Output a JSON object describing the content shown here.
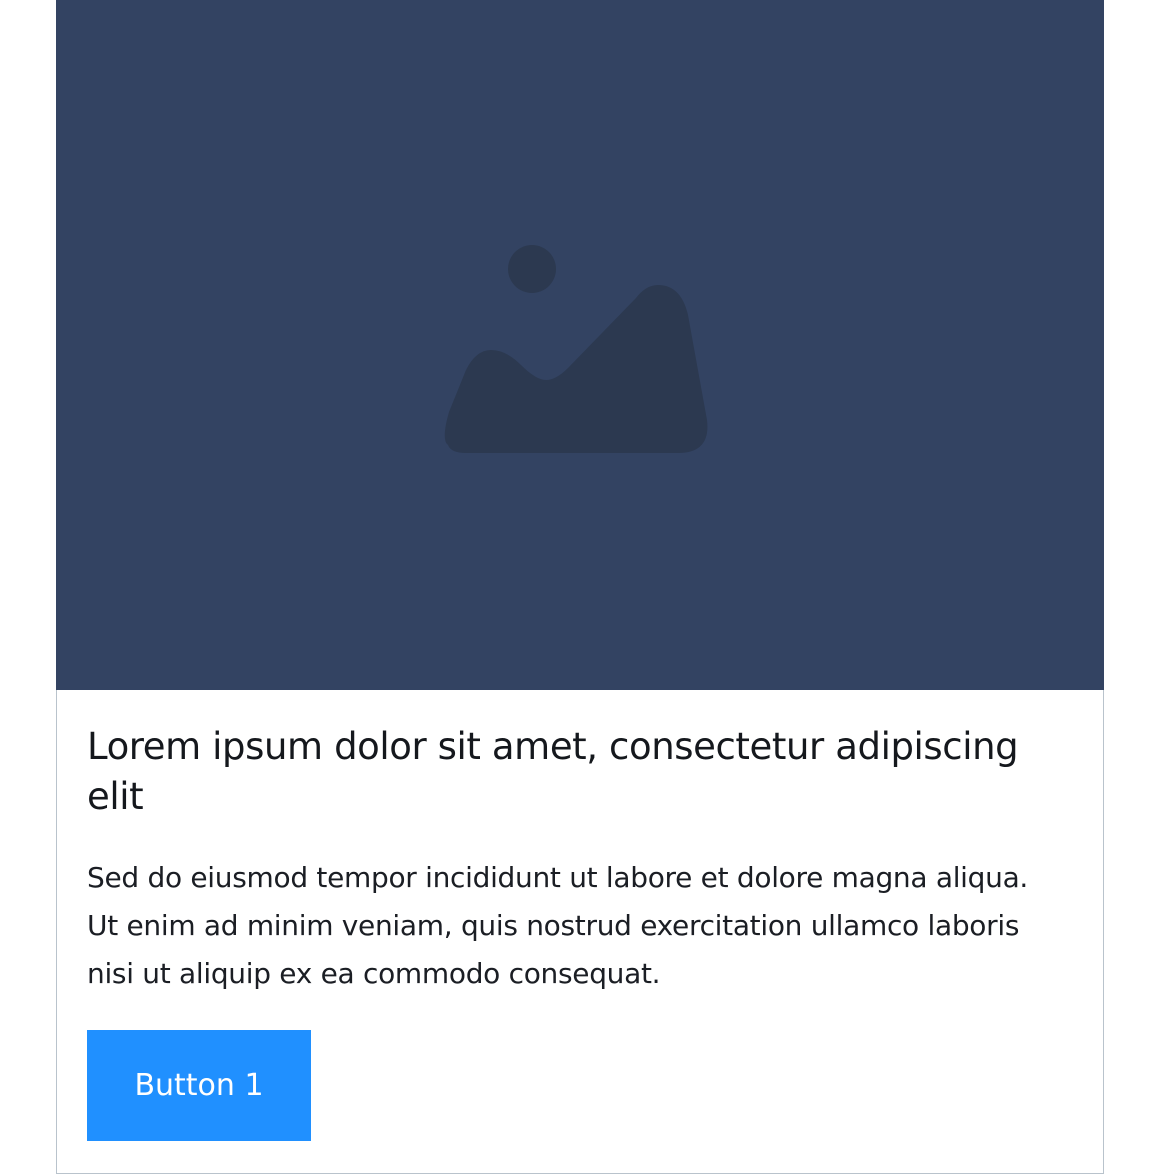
{
  "card": {
    "image": {
      "icon": "image-placeholder-icon",
      "background_color": "#334362",
      "icon_color": "#2c3950"
    },
    "title": "Lorem ipsum dolor sit amet, consectetur adipiscing elit",
    "description": "Sed do eiusmod tempor incididunt ut labore et dolore magna aliqua. Ut enim ad minim veniam, quis nostrud exercitation ullamco laboris nisi ut aliquip ex ea commodo consequat.",
    "button_label": "Button 1",
    "button_color": "#2090ff"
  }
}
